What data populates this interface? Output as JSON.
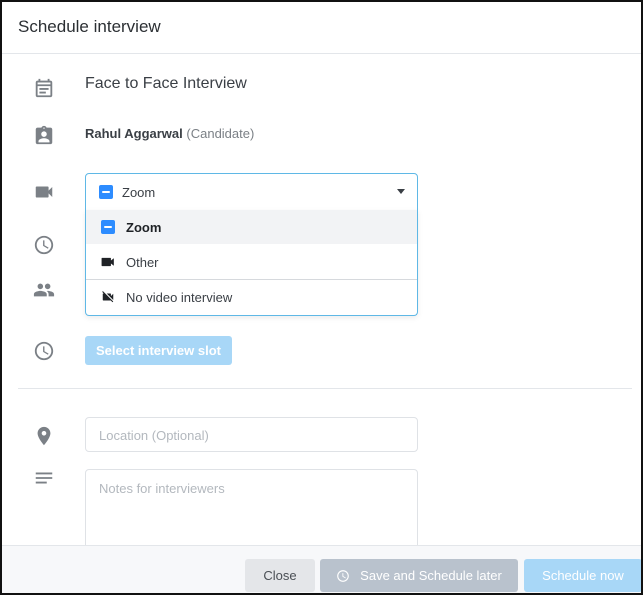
{
  "dialog": {
    "title": "Schedule interview"
  },
  "interview": {
    "type": "Face to Face Interview",
    "candidate_name": "Rahul Aggarwal",
    "candidate_role": "(Candidate)"
  },
  "video": {
    "selected": "Zoom",
    "options": [
      {
        "label": "Zoom",
        "icon": "zoom-icon",
        "selected": true
      },
      {
        "label": "Other",
        "icon": "video-camera-icon",
        "selected": false
      },
      {
        "label": "No video interview",
        "icon": "video-off-icon",
        "selected": false
      }
    ]
  },
  "slot": {
    "button_label": "Select interview slot"
  },
  "location": {
    "placeholder": "Location (Optional)"
  },
  "notes": {
    "placeholder": "Notes for interviewers"
  },
  "footer": {
    "close_label": "Close",
    "save_later_label": "Save and Schedule later",
    "schedule_now_label": "Schedule now"
  },
  "colors": {
    "accent": "#5fb8e6",
    "zoom_blue": "#2d8cff",
    "disabled_primary": "#a8d7f7",
    "disabled_secondary": "#b9c2cd"
  }
}
